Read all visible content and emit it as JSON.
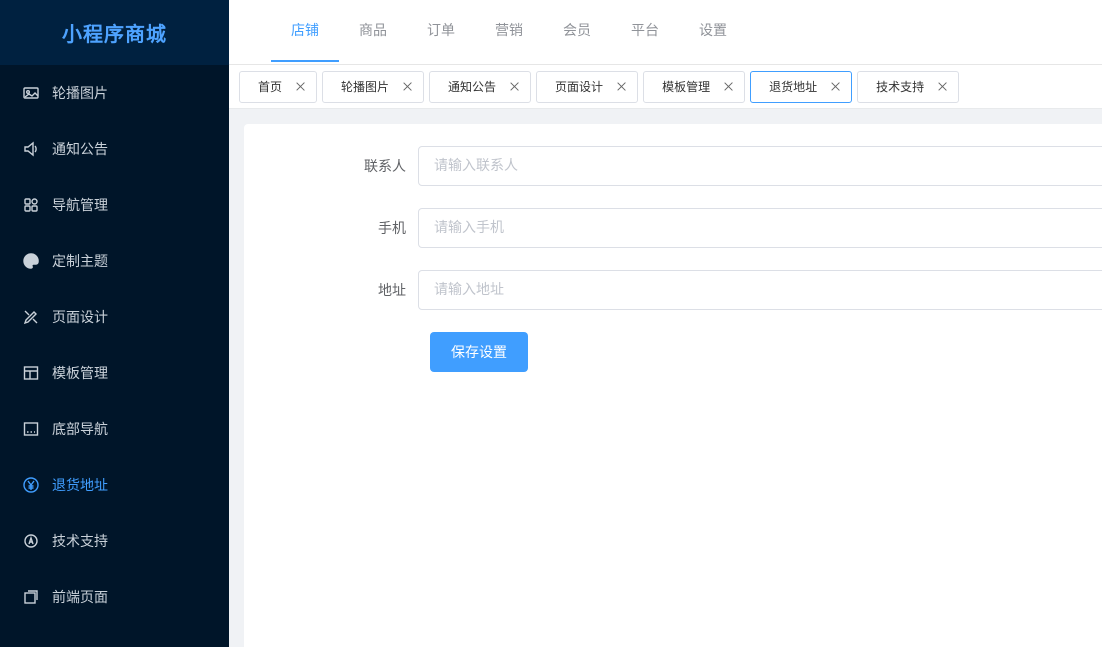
{
  "app": {
    "title": "小程序商城"
  },
  "sidebar": {
    "items": [
      {
        "label": "轮播图片",
        "icon": "image-icon"
      },
      {
        "label": "通知公告",
        "icon": "speaker-icon"
      },
      {
        "label": "导航管理",
        "icon": "grid-icon"
      },
      {
        "label": "定制主题",
        "icon": "palette-icon"
      },
      {
        "label": "页面设计",
        "icon": "design-icon"
      },
      {
        "label": "模板管理",
        "icon": "template-icon"
      },
      {
        "label": "底部导航",
        "icon": "bottom-nav-icon"
      },
      {
        "label": "退货地址",
        "icon": "yen-icon",
        "active": true
      },
      {
        "label": "技术支持",
        "icon": "support-icon"
      },
      {
        "label": "前端页面",
        "icon": "pages-icon"
      }
    ]
  },
  "topnav": {
    "items": [
      "店铺",
      "商品",
      "订单",
      "营销",
      "会员",
      "平台",
      "设置"
    ],
    "active": "店铺"
  },
  "tabs": {
    "items": [
      "首页",
      "轮播图片",
      "通知公告",
      "页面设计",
      "模板管理",
      "退货地址",
      "技术支持"
    ],
    "active": "退货地址"
  },
  "form": {
    "contact_label": "联系人",
    "contact_placeholder": "请输入联系人",
    "contact_value": "",
    "phone_label": "手机",
    "phone_placeholder": "请输入手机",
    "phone_value": "",
    "address_label": "地址",
    "address_placeholder": "请输入地址",
    "address_value": "",
    "save_label": "保存设置"
  },
  "colors": {
    "sidebar_bg": "#001529",
    "accent": "#409eff"
  }
}
